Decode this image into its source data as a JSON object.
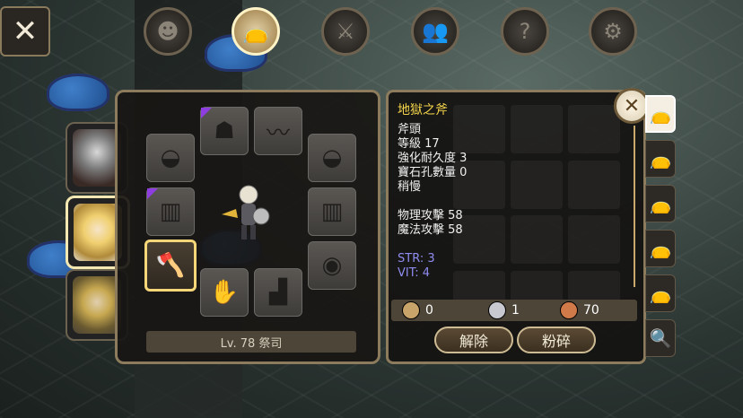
{
  "close_main": {
    "icon": "close-icon",
    "glyph": "✕"
  },
  "top_tabs": [
    {
      "name": "profile-tab",
      "icon": "head-silhouette-icon",
      "glyph": "☻"
    },
    {
      "name": "inventory-tab",
      "icon": "bag-icon",
      "glyph": "👝"
    },
    {
      "name": "skills-tab",
      "icon": "sword-icon",
      "glyph": "⚔"
    },
    {
      "name": "party-tab",
      "icon": "people-icon",
      "glyph": "👥"
    },
    {
      "name": "quest-tab",
      "icon": "scroll-question-icon",
      "glyph": "?"
    },
    {
      "name": "settings-tab",
      "icon": "gear-icon",
      "glyph": "⚙"
    }
  ],
  "equipment": {
    "level_label": "Lv. 78 祭司",
    "slots": [
      {
        "icon": "bandage-head-icon",
        "glyph": "☗"
      },
      {
        "icon": "cape-icon",
        "glyph": "〰"
      },
      {
        "icon": "hat-icon",
        "glyph": "◒"
      },
      {
        "icon": "hat-icon",
        "glyph": "◒"
      },
      {
        "icon": "armor-icon",
        "glyph": "▥"
      },
      {
        "icon": "armor-icon",
        "glyph": "▥"
      },
      {
        "icon": "axe-icon",
        "glyph": "🪓"
      },
      {
        "icon": "shield-icon",
        "glyph": "◉"
      },
      {
        "icon": "glove-icon",
        "glyph": "✋"
      },
      {
        "icon": "boot-icon",
        "glyph": "▟"
      }
    ]
  },
  "item": {
    "name": "地獄之斧",
    "type": "斧頭",
    "level": "等級 17",
    "durability": "強化耐久度 3",
    "gem_slots": "寶石孔數量 0",
    "speed": "稍慢",
    "phys_atk": "物理攻擊 58",
    "mag_atk": "魔法攻擊 58",
    "str": "STR: 3",
    "vit": "VIT: 4"
  },
  "currency": {
    "gold": "0",
    "silver": "1",
    "copper": "70",
    "colors": {
      "gold": "#c9a46a",
      "silver": "#c8c8d0",
      "copper": "#d07a4a"
    }
  },
  "buttons": {
    "remove": "解除",
    "shatter": "粉碎"
  },
  "side_tabs": [
    "bag-icon",
    "bag-icon",
    "bag-icon",
    "bag-icon",
    "bag-icon",
    "bag-search-icon"
  ],
  "colors": {
    "item_name": "#f3d34a",
    "stat_blue": "#8f8cf0",
    "frame": "#8c7b5c"
  }
}
